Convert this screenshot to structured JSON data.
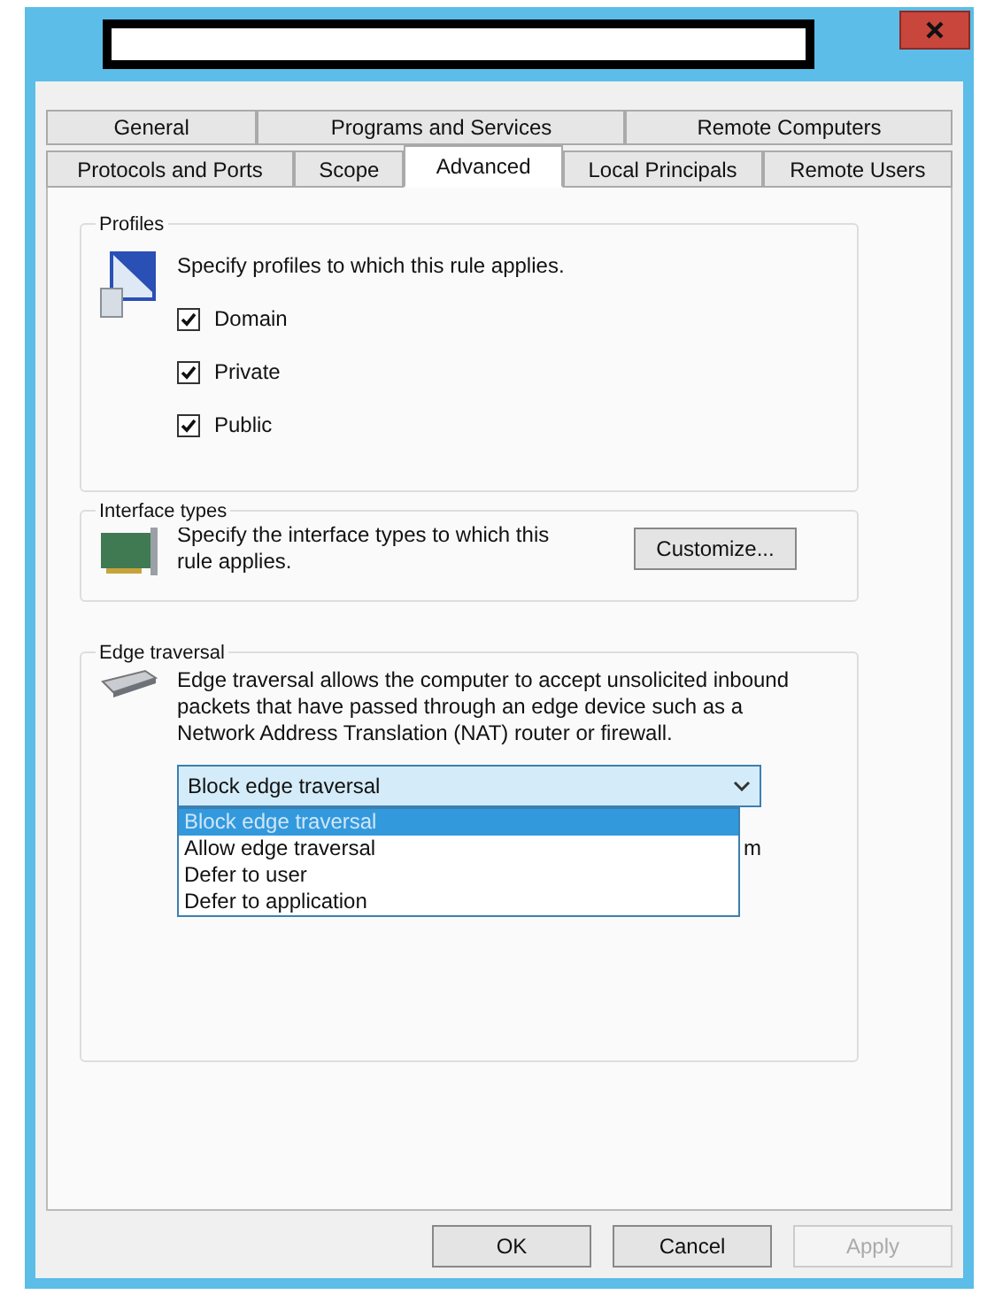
{
  "tabs": [
    [
      {
        "label": "General",
        "selected": false
      },
      {
        "label": "Programs and Services",
        "selected": false
      },
      {
        "label": "Remote Computers",
        "selected": false
      }
    ],
    [
      {
        "label": "Protocols and Ports",
        "selected": false
      },
      {
        "label": "Scope",
        "selected": false
      },
      {
        "label": "Advanced",
        "selected": true
      },
      {
        "label": "Local Principals",
        "selected": false
      },
      {
        "label": "Remote Users",
        "selected": false
      }
    ]
  ],
  "profiles": {
    "title": "Profiles",
    "description": "Specify profiles to which this rule applies.",
    "options": [
      {
        "label": "Domain",
        "checked": true
      },
      {
        "label": "Private",
        "checked": true
      },
      {
        "label": "Public",
        "checked": true
      }
    ]
  },
  "interface_types": {
    "title": "Interface types",
    "description": "Specify the interface types to which this rule applies.",
    "button": "Customize..."
  },
  "edge_traversal": {
    "title": "Edge traversal",
    "description": "Edge traversal allows the computer to accept unsolicited inbound packets that have passed through an edge device such as a Network Address Translation (NAT) router or firewall.",
    "dropdown": {
      "value": "Block edge traversal",
      "expanded": true,
      "options": [
        {
          "label": "Block edge traversal",
          "selected": true
        },
        {
          "label": "Allow edge traversal",
          "selected": false
        },
        {
          "label": "Defer to user",
          "selected": false
        },
        {
          "label": "Defer to application",
          "selected": false
        }
      ]
    },
    "covered_text": "m"
  },
  "buttons": [
    {
      "label": "OK",
      "disabled": false
    },
    {
      "label": "Cancel",
      "disabled": false
    },
    {
      "label": "Apply",
      "disabled": true
    }
  ]
}
